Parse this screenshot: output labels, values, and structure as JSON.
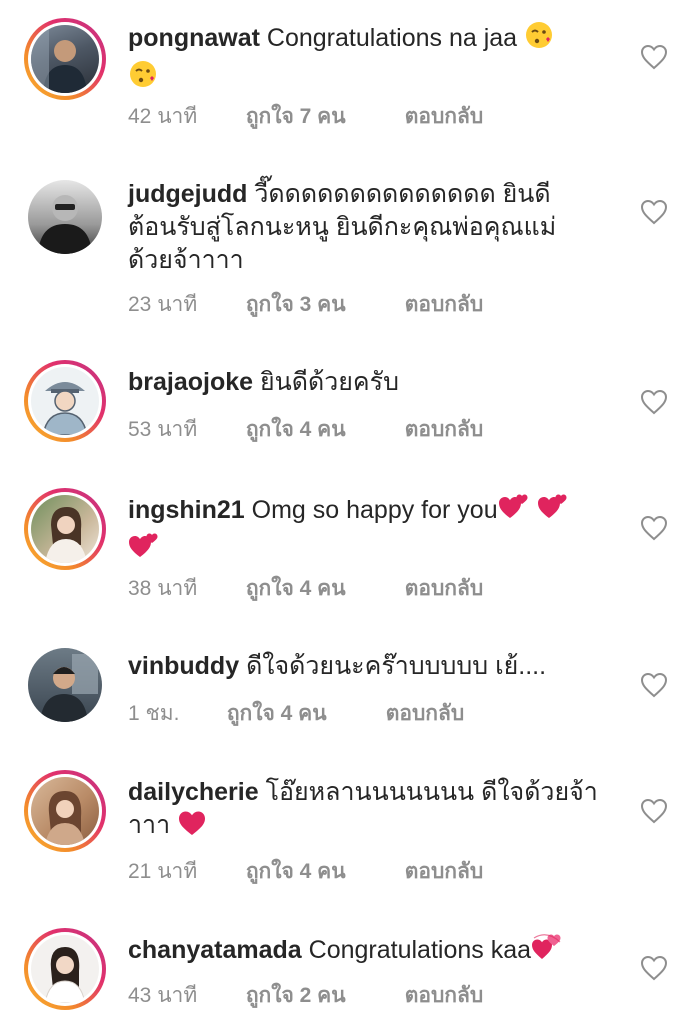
{
  "comments": [
    {
      "username": "pongnawat",
      "text": "Congratulations na jaa",
      "time": "42 นาที",
      "likes": "ถูกใจ 7 คน",
      "reply": "ตอบกลับ",
      "avatar_style": "story",
      "emoji": [
        "kissing-face-icon",
        "kissing-face-icon"
      ]
    },
    {
      "username": "judgejudd",
      "text": "วี๊ดดดดดดดดดดดดดด ยินดีต้อนรับสู่โลกนะหนู ยินดีกะคุณพ่อคุณแม่ด้วยจ้าาาา",
      "time": "23 นาที",
      "likes": "ถูกใจ 3 คน",
      "reply": "ตอบกลับ",
      "avatar_style": "plain"
    },
    {
      "username": "brajaojoke",
      "text": "ยินดีด้วยครับ",
      "time": "53 นาที",
      "likes": "ถูกใจ 4 คน",
      "reply": "ตอบกลับ",
      "avatar_style": "story"
    },
    {
      "username": "ingshin21",
      "text": "Omg so happy for you",
      "time": "38 นาที",
      "likes": "ถูกใจ 4 คน",
      "reply": "ตอบกลับ",
      "avatar_style": "story",
      "emoji": [
        "two-hearts-icon",
        "two-hearts-icon",
        "two-hearts-icon"
      ]
    },
    {
      "username": "vinbuddy",
      "text": "ดีใจด้วยนะคร๊าบบบบบ  เย้....",
      "time": "1 ชม.",
      "likes": "ถูกใจ 4 คน",
      "reply": "ตอบกลับ",
      "avatar_style": "plain"
    },
    {
      "username": "dailycherie",
      "text": "โอ๊ยหลานนนนนนน ดีใจด้วยจ้าาาา",
      "time": "21 นาที",
      "likes": "ถูกใจ 4 คน",
      "reply": "ตอบกลับ",
      "avatar_style": "story",
      "emoji": [
        "red-heart-icon"
      ]
    },
    {
      "username": "chanyatamada",
      "text": "Congratulations kaa",
      "time": "43 นาที",
      "likes": "ถูกใจ 2 คน",
      "reply": "ตอบกลับ",
      "avatar_style": "story",
      "emoji": [
        "revolving-hearts-icon"
      ]
    }
  ],
  "colors": {
    "text": "#262626",
    "meta": "#8e8e8e",
    "heart_outline": "#8e8e8e",
    "emoji_heart": "#e0245e",
    "emoji_face": "#ffcc33"
  }
}
